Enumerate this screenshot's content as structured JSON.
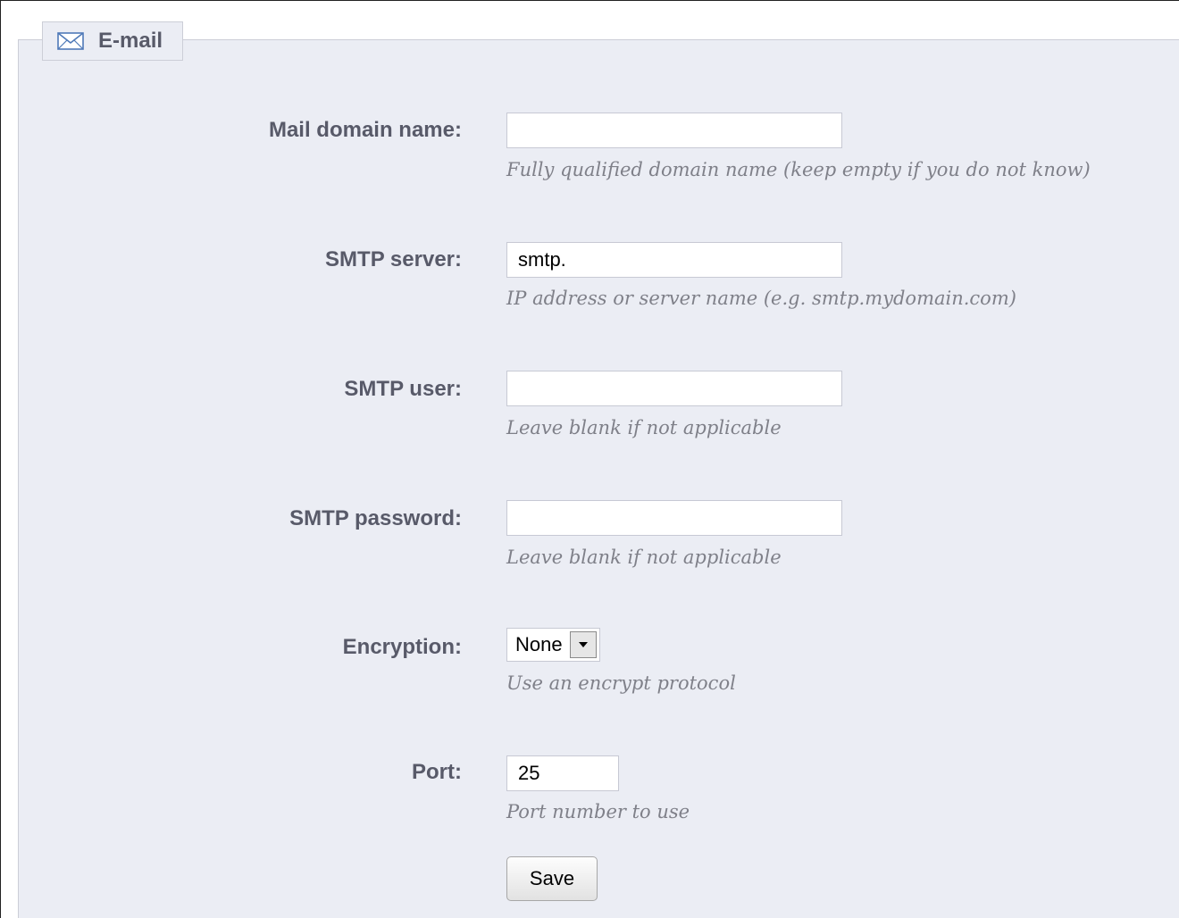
{
  "section": {
    "title": "E-mail",
    "icon": "envelope-icon"
  },
  "fields": {
    "mail_domain": {
      "label": "Mail domain name:",
      "value": "",
      "hint": "Fully qualified domain name (keep empty if you do not know)"
    },
    "smtp_server": {
      "label": "SMTP server:",
      "value": "smtp.",
      "hint": "IP address or server name (e.g. smtp.mydomain.com)"
    },
    "smtp_user": {
      "label": "SMTP user:",
      "value": "",
      "hint": "Leave blank if not applicable"
    },
    "smtp_password": {
      "label": "SMTP password:",
      "value": "",
      "hint": "Leave blank if not applicable"
    },
    "encryption": {
      "label": "Encryption:",
      "selected": "None",
      "hint": "Use an encrypt protocol"
    },
    "port": {
      "label": "Port:",
      "value": "25",
      "hint": "Port number to use"
    }
  },
  "actions": {
    "save_label": "Save"
  },
  "colors": {
    "panel_background": "#ebedf4",
    "label_text": "#585a69",
    "hint_text": "#7f8089",
    "icon_blue": "#4f79b8"
  }
}
